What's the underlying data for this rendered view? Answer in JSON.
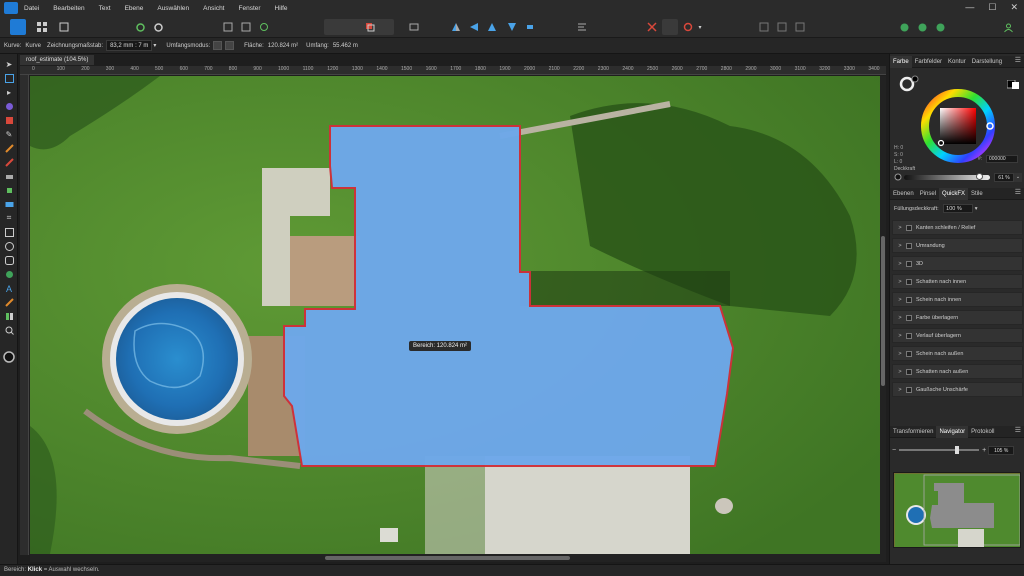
{
  "menubar": {
    "items": [
      "Datei",
      "Bearbeiten",
      "Text",
      "Ebene",
      "Auswählen",
      "Ansicht",
      "Fenster",
      "Hilfe"
    ],
    "win_minimize": "—",
    "win_maximize": "☐",
    "win_close": "✕"
  },
  "context": {
    "tool_label": "Kurve:",
    "tool_value": "Kurve",
    "scale_label": "Zeichnungsmaßstab:",
    "scale_value": "83,2 mm : 7 m",
    "scale_chevron": "▾",
    "mode_label": "Umfangsmodus:",
    "area_label": "Fläche:",
    "area_value": "120.824 m²",
    "perimeter_label": "Umfang:",
    "perimeter_value": "55.462 m"
  },
  "document": {
    "tab_title": "roof_estimate (104.5%)",
    "ruler_ticks": [
      "0",
      "100",
      "200",
      "300",
      "400",
      "500",
      "600",
      "700",
      "800",
      "900",
      "1000",
      "1100",
      "1200",
      "1300",
      "1400",
      "1500",
      "1600",
      "1700",
      "1800",
      "1900",
      "2000",
      "2100",
      "2200",
      "2300",
      "2400",
      "2500",
      "2600",
      "2700",
      "2800",
      "2900",
      "3000",
      "3100",
      "3200",
      "3300",
      "3400"
    ],
    "area_tooltip": "Bereich: 120.824 m²"
  },
  "colors": {
    "selection_fill": "#6ea8ea",
    "selection_stroke": "#d0303a",
    "accent": "#1f7bd6"
  },
  "color_panel": {
    "tabs": [
      "Farbe",
      "Farbfelder",
      "Kontur",
      "Darstellung"
    ],
    "active_tab": "Farbe",
    "hsl": [
      "H: 0",
      "S: 0",
      "L: 0"
    ],
    "hex_value": "000000",
    "opacity_label": "Deckkraft",
    "opacity_value": "61 %",
    "opacity_fraction": 0.61,
    "menu": "☰",
    "hex_prefix": "#:",
    "dropdown": "⌄"
  },
  "layers_panel": {
    "tabs": [
      "Ebenen",
      "Pinsel",
      "QuickFX",
      "Stile"
    ],
    "active_tab": "QuickFX",
    "fill_opacity_label": "Füllungsdeckkraft:",
    "fill_opacity_value": "100 %",
    "fill_opacity_chevron": "▾",
    "chevron": ">",
    "effects": [
      "Kanten schleifen / Relief",
      "Umrandung",
      "3D",
      "Schatten nach innen",
      "Schein nach innen",
      "Farbe überlagern",
      "Verlauf überlagern",
      "Schein nach außen",
      "Schatten nach außen",
      "Gaußsche Unschärfe"
    ]
  },
  "navigator_panel": {
    "tabs": [
      "Transformieren",
      "Navigator",
      "Protokoll"
    ],
    "active_tab": "Navigator",
    "zoom_value": "105 %",
    "zoom_out": "−",
    "zoom_in": "+"
  },
  "statusbar": {
    "prefix": "Bereich:",
    "action": "Klick",
    "suffix": "= Auswahl wechseln."
  }
}
